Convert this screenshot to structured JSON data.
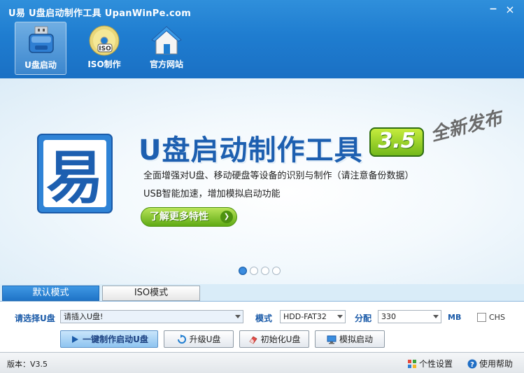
{
  "window": {
    "title": "U易  U盘启动制作工具  UpanWinPe.com",
    "minimize": "−",
    "close": "×"
  },
  "nav": [
    {
      "label": "U盘启动",
      "icon": "usb-drive-icon",
      "active": true
    },
    {
      "label": "ISO制作",
      "icon": "cd-disc-icon",
      "active": false
    },
    {
      "label": "官方网站",
      "icon": "home-icon",
      "active": false
    }
  ],
  "banner": {
    "logo_char": "易",
    "title": "U盘启动制作工具",
    "version_badge": "3.5",
    "stamp": "全新发布",
    "desc1": "全面增强对U盘、移动硬盘等设备的识别与制作（请注意备份数据）",
    "desc2": "USB智能加速，增加模拟启动功能",
    "more_button": "了解更多特性",
    "more_arrow": "❯",
    "slides": 4,
    "active_slide": 0
  },
  "tabs": [
    {
      "label": "默认模式",
      "active": true
    },
    {
      "label": "ISO模式",
      "active": false
    }
  ],
  "form": {
    "select_u_label": "请选择U盘",
    "select_u_value": "请插入U盘!",
    "mode_label": "模式",
    "mode_value": "HDD-FAT32",
    "partition_label": "分配",
    "partition_value": "330",
    "unit": "MB",
    "chs_label": "CHS",
    "chs_checked": false
  },
  "buttons": {
    "one_click": "一键制作启动U盘",
    "upgrade": "升级U盘",
    "init": "初始化U盘",
    "simulate": "模拟启动"
  },
  "status": {
    "version": "版本：V3.5",
    "settings": "个性设置",
    "help": "使用帮助"
  },
  "colors": {
    "header": "#1f7dd0",
    "accent_green": "#5faa14",
    "title_blue": "#1d5fb0"
  }
}
